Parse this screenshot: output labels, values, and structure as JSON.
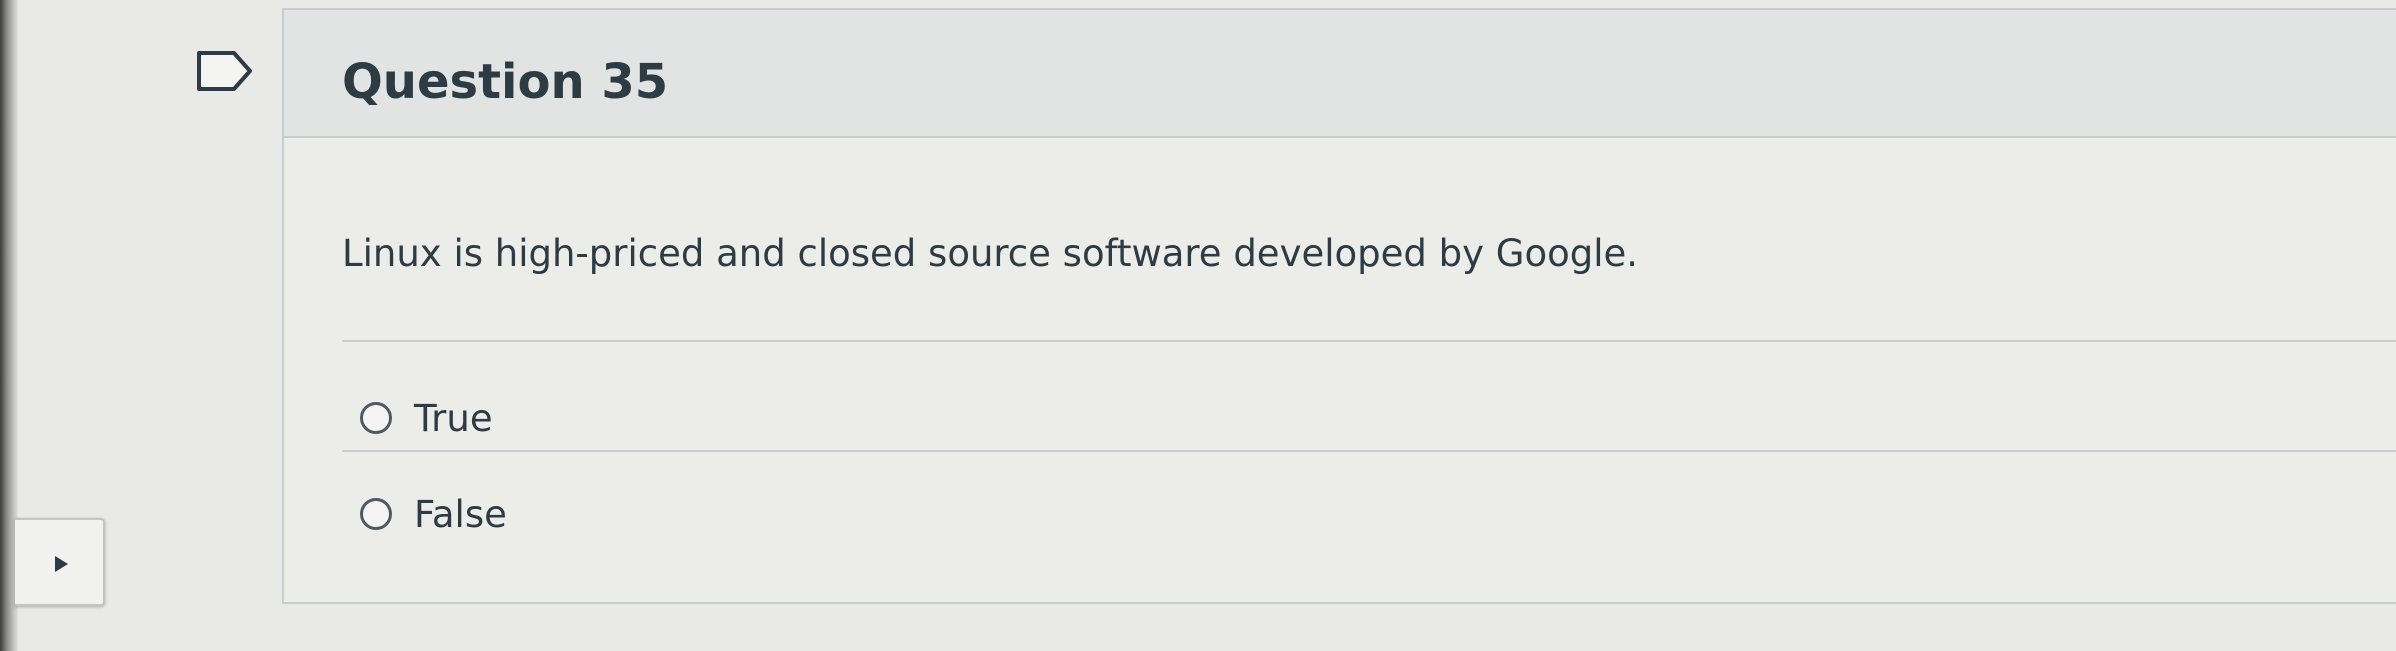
{
  "question": {
    "title": "Question 35",
    "text": "Linux is high-priced and closed source software developed by Google.",
    "answers": [
      {
        "label": "True",
        "selected": false
      },
      {
        "label": "False",
        "selected": false
      }
    ]
  },
  "icons": {
    "flag": "flag-outline-icon",
    "side_toggle": "caret-right-icon"
  },
  "colors": {
    "text": "#2d3b45",
    "border": "#c7cdd1",
    "background": "#e9e9e7"
  }
}
